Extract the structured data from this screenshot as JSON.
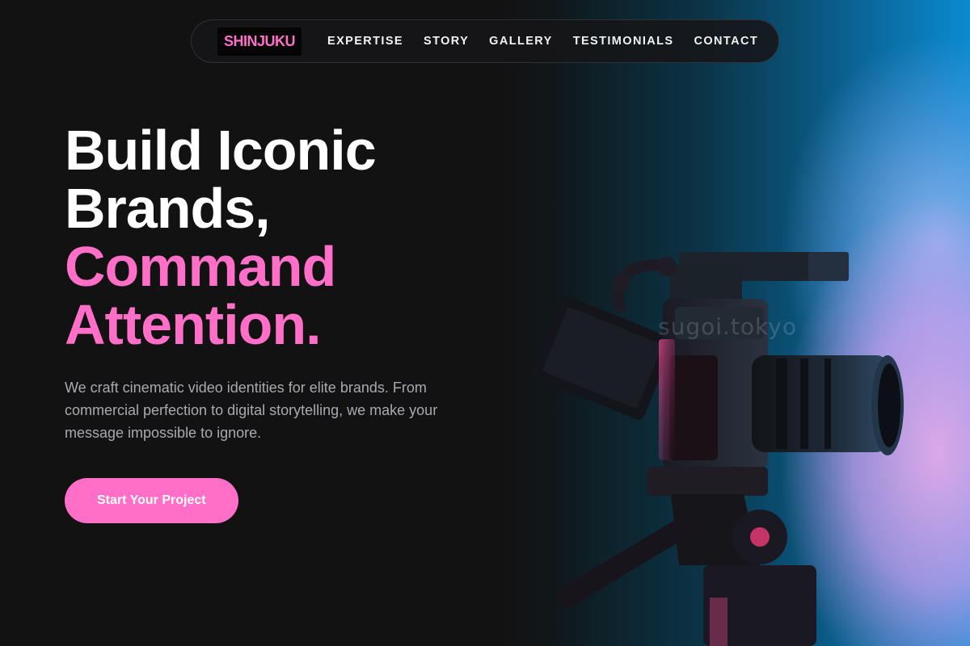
{
  "nav": {
    "logo": "SHINJUKU",
    "links": [
      "EXPERTISE",
      "STORY",
      "GALLERY",
      "TESTIMONIALS",
      "CONTACT"
    ]
  },
  "hero": {
    "headline_line1": "Build Iconic",
    "headline_line2": "Brands,",
    "headline_line3": "Command",
    "headline_line4": "Attention.",
    "subtext": "We craft cinematic video identities for elite brands. From commercial perfection to digital storytelling, we make your message impossible to ignore.",
    "cta_label": "Start Your Project"
  },
  "image": {
    "subject": "camera-on-tripod",
    "watermark": "sugoi.tokyo"
  },
  "colors": {
    "accent": "#ff6ec7",
    "background": "#121212",
    "nav_bg": "#161618",
    "subtext": "#a9a9b0"
  }
}
